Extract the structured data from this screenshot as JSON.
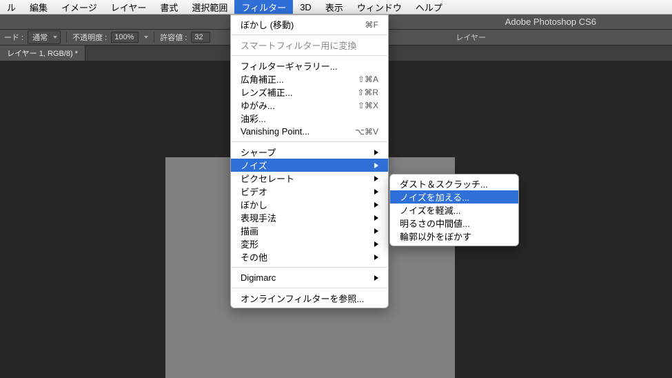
{
  "menubar": {
    "items": [
      "ル",
      "編集",
      "イメージ",
      "レイヤー",
      "書式",
      "選択範囲",
      "フィルター",
      "3D",
      "表示",
      "ウィンドウ",
      "ヘルプ"
    ],
    "active_index": 6
  },
  "app_title": "Adobe Photoshop CS6",
  "option_bar": {
    "mode_label": "ード :",
    "mode_value": "通常",
    "opacity_label": "不透明度 :",
    "opacity_value": "100%",
    "tolerance_label": "許容値 :",
    "tolerance_value": "32",
    "layer_label": "レイヤー"
  },
  "tab": {
    "label": "レイヤー 1, RGB/8) *"
  },
  "filter_menu": {
    "last": {
      "label": "ぼかし (移動)",
      "shortcut": "⌘F"
    },
    "group1": [
      {
        "label": "スマートフィルター用に変換",
        "shortcut": ""
      }
    ],
    "group2": [
      {
        "label": "フィルターギャラリー...",
        "shortcut": ""
      },
      {
        "label": "広角補正...",
        "shortcut": "⇧⌘A"
      },
      {
        "label": "レンズ補正...",
        "shortcut": "⇧⌘R"
      },
      {
        "label": "ゆがみ...",
        "shortcut": "⇧⌘X"
      },
      {
        "label": "油彩...",
        "shortcut": ""
      },
      {
        "label": "Vanishing Point...",
        "shortcut": "⌥⌘V"
      }
    ],
    "group3": [
      {
        "label": "シャープ",
        "sub": true
      },
      {
        "label": "ノイズ",
        "sub": true,
        "hl": true
      },
      {
        "label": "ピクセレート",
        "sub": true
      },
      {
        "label": "ビデオ",
        "sub": true
      },
      {
        "label": "ぼかし",
        "sub": true
      },
      {
        "label": "表現手法",
        "sub": true
      },
      {
        "label": "描画",
        "sub": true
      },
      {
        "label": "変形",
        "sub": true
      },
      {
        "label": "その他",
        "sub": true
      }
    ],
    "group4": [
      {
        "label": "Digimarc",
        "sub": true
      }
    ],
    "group5": [
      {
        "label": "オンラインフィルターを参照...",
        "shortcut": ""
      }
    ]
  },
  "noise_submenu": [
    {
      "label": "ダスト＆スクラッチ..."
    },
    {
      "label": "ノイズを加える...",
      "hl": true
    },
    {
      "label": "ノイズを軽減..."
    },
    {
      "label": "明るさの中間値..."
    },
    {
      "label": "輪郭以外をぼかす"
    }
  ]
}
